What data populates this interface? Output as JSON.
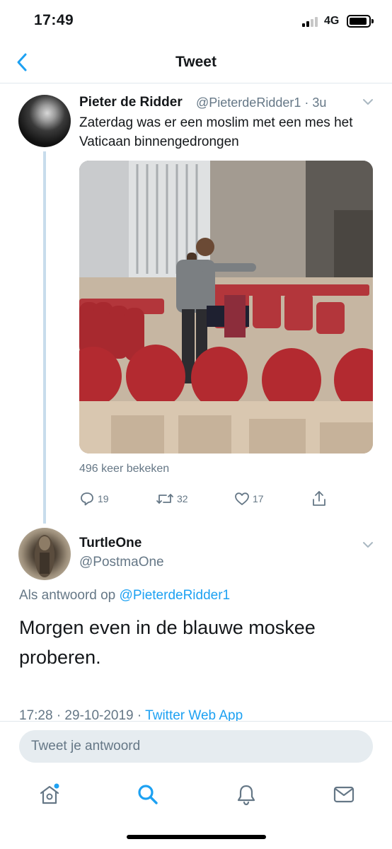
{
  "status_bar": {
    "time": "17:49",
    "network": "4G"
  },
  "header": {
    "title": "Tweet"
  },
  "tweet": {
    "author_name": "Pieter de Ridder",
    "author_handle": "@PieterdeRidder1 · 3u",
    "text": "Zaterdag was er een moslim met een mes het Vaticaan binnengedrongen",
    "views": "496 keer bekeken",
    "reply_count": "19",
    "retweet_count": "32",
    "like_count": "17"
  },
  "reply": {
    "author_name": "TurtleOne",
    "author_handle": "@PostmaOne",
    "reply_prefix": "Als antwoord op",
    "reply_to": "@PieterdeRidder1",
    "text": "Morgen even in de blauwe moskee proberen.",
    "timestamp": "17:28 · 29-10-2019 · ",
    "source": "Twitter Web App"
  },
  "compose": {
    "placeholder": "Tweet je antwoord"
  },
  "colors": {
    "accent": "#1da1f2",
    "secondary_text": "#657786",
    "primary_text": "#14171a"
  },
  "tabs": [
    {
      "icon": "home-icon",
      "has_notification_dot": true
    },
    {
      "icon": "search-icon",
      "active": true
    },
    {
      "icon": "bell-icon"
    },
    {
      "icon": "mail-icon"
    }
  ]
}
